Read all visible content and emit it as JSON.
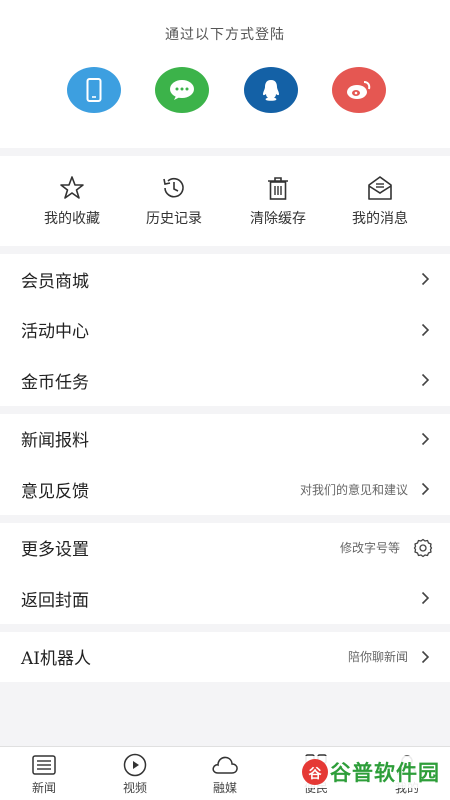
{
  "login": {
    "title": "通过以下方式登陆",
    "methods": [
      {
        "name": "phone",
        "icon": "phone-icon",
        "color": "#3d9fe0"
      },
      {
        "name": "wechat",
        "icon": "wechat-icon",
        "color": "#3cb34a"
      },
      {
        "name": "qq",
        "icon": "qq-icon",
        "color": "#1461a6"
      },
      {
        "name": "weibo",
        "icon": "weibo-icon",
        "color": "#e55752"
      }
    ]
  },
  "quick_actions": [
    {
      "label": "我的收藏",
      "icon": "star-icon"
    },
    {
      "label": "历史记录",
      "icon": "history-icon"
    },
    {
      "label": "清除缓存",
      "icon": "trash-icon"
    },
    {
      "label": "我的消息",
      "icon": "mail-icon"
    }
  ],
  "groups": [
    [
      {
        "label": "会员商城"
      },
      {
        "label": "活动中心"
      },
      {
        "label": "金币任务"
      }
    ],
    [
      {
        "label": "新闻报料"
      },
      {
        "label": "意见反馈",
        "sub": "对我们的意见和建议"
      }
    ],
    [
      {
        "label": "更多设置",
        "sub": "修改字号等",
        "icon": "gear-icon"
      },
      {
        "label": "返回封面"
      }
    ],
    [
      {
        "label": "AI机器人",
        "sub": "陪你聊新闻"
      }
    ]
  ],
  "tabbar": [
    {
      "label": "新闻",
      "icon": "news-list-icon"
    },
    {
      "label": "视频",
      "icon": "play-icon"
    },
    {
      "label": "融媒",
      "icon": "cloud-icon"
    },
    {
      "label": "便民",
      "icon": "service-icon"
    },
    {
      "label": "我的",
      "icon": "user-icon"
    }
  ],
  "watermark": {
    "logo": "谷",
    "text_a": "谷普",
    "text_b": "软件园"
  }
}
